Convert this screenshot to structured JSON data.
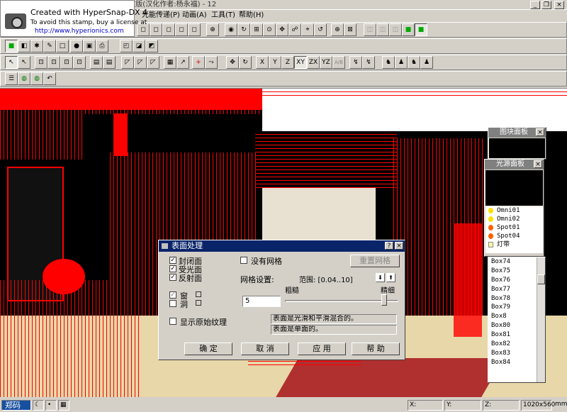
{
  "window": {
    "title": "渲染巨匠Lightscape 3.2 SP1简体中文版(汉化作者:杨永福) - 12",
    "minimize": "_",
    "restore": "❐",
    "close": "×"
  },
  "stamp": {
    "line1": "Created with HyperSnap-DX 4",
    "line2": "To avoid this stamp, buy a license at",
    "line3": "http://www.hyperionics.com"
  },
  "menu": [
    "文",
    "光能传递(P)",
    "动画(A)",
    "工具(T)",
    "帮助(H)"
  ],
  "toolbar": {
    "axis_x": "X",
    "axis_y": "Y",
    "axis_z": "Z",
    "plane_xy": "XY",
    "plane_zx": "ZX",
    "plane_yz": "YZ",
    "plane_abs": "A/B"
  },
  "panels": {
    "block": {
      "title": "图块面板",
      "close": "×"
    },
    "light": {
      "title": "光源面板",
      "close": "×",
      "items": [
        "Omni01",
        "Omni02",
        "Spot01",
        "Spot04",
        "灯带"
      ]
    },
    "box_list": {
      "items": [
        "Box74",
        "Box75",
        "Box76",
        "Box77",
        "Box78",
        "Box79",
        "Box8",
        "Box80",
        "Box81",
        "Box82",
        "Box83",
        "Box84"
      ]
    }
  },
  "dialog": {
    "title": "表面处理",
    "help": "?",
    "close": "×",
    "check_closed": "封闭面",
    "check_receive": "受光面",
    "check_reflect": "反射面",
    "check_window": "窗",
    "check_hole": "洞",
    "check_original_texture": "显示原始纹理",
    "no_mesh": "没有网格",
    "reset_mesh": "重置网格",
    "mesh_settings": "网格设置:",
    "range": "范围: [0.04..10]",
    "coarse": "粗糙",
    "fine": "精细",
    "mesh_value": "5",
    "info1": "表面是光滑和平滑混合的。",
    "info2": "表面是单面的。",
    "ok": "确 定",
    "cancel": "取 消",
    "apply": "应 用",
    "help_button": "帮 助"
  },
  "status": {
    "start": "郑码",
    "x": "X:",
    "y": "Y:",
    "z": "Z:",
    "resolution": "1020x560",
    "unit": "mm"
  },
  "colors": {
    "wireframe": "#ff0000",
    "dialog_title": "#0a246a",
    "panel_title": "#808080",
    "floor": "#e8d7a8"
  }
}
